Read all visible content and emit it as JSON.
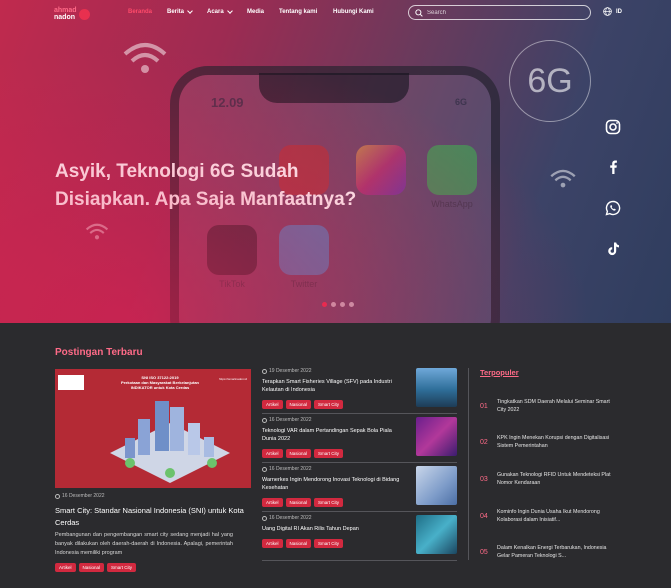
{
  "nav": {
    "logo": {
      "top": "ahmad",
      "bottom": "nadon"
    },
    "items": [
      {
        "label": "Beranda",
        "active": true,
        "dropdown": false
      },
      {
        "label": "Berita",
        "active": false,
        "dropdown": true
      },
      {
        "label": "Acara",
        "active": false,
        "dropdown": true
      },
      {
        "label": "Media",
        "active": false,
        "dropdown": false
      },
      {
        "label": "Tentang kami",
        "active": false,
        "dropdown": false
      },
      {
        "label": "Hubungi Kami",
        "active": false,
        "dropdown": false
      }
    ],
    "search_placeholder": "Search",
    "language": "ID"
  },
  "hero": {
    "title_line1": "Asyik, Teknologi 6G Sudah",
    "title_line2": "Disiapkan. Apa Saja  Manfaatnya?",
    "phone_time": "12.09",
    "phone_network": "6G",
    "badge": "6G",
    "app_labels": {
      "whatsapp": "WhatsApp",
      "tiktok": "TikTok",
      "twitter": "Twitter"
    },
    "slides": 4,
    "active_slide": 0
  },
  "social": [
    "instagram-icon",
    "facebook-icon",
    "whatsapp-icon",
    "tiktok-icon"
  ],
  "latest": {
    "section_title": "Postingan Terbaru",
    "featured": {
      "image_heading": "SNI ISO 37122:2019\nPerkotaan dan Masyarakat Berkelanjutan\nINDIKATOR untuk Kota Cerdas",
      "image_url": "https://smartnadon.id",
      "date": "16 Desember 2022",
      "title": "Smart City: Standar Nasional Indonesia (SNI) untuk Kota Cerdas",
      "excerpt": "Pembangunan dan pengembangan smart city sedang menjadi hal yang banyak dilakukan oleh daerah-daerah di Indonesia. Apalagi, pemerintah Indonesia memiliki program",
      "tags": [
        "Artikel",
        "Nasional",
        "Smart City"
      ]
    },
    "items": [
      {
        "date": "19 Desember 2022",
        "title": "Terapkan Smart Fisheries Village (SFV) pada Industri Kelautan di Indonesia",
        "tags": [
          "Artikel",
          "Nasional",
          "Smart City"
        ]
      },
      {
        "date": "16 Desember 2022",
        "title": "Teknologi VAR dalam Pertandingan Sepak Bola Piala Dunia 2022",
        "tags": [
          "Artikel",
          "Nasional",
          "Smart City"
        ]
      },
      {
        "date": "16 Desember 2022",
        "title": "Warnerkes Ingin Mendorong Inovasi Teknologi di Bidang Kesehatan",
        "tags": [
          "Artikel",
          "Nasional",
          "Smart City"
        ]
      },
      {
        "date": "16 Desember 2022",
        "title": "Uang Digital RI Akan Rilis Tahun Depan",
        "tags": [
          "Artikel",
          "Nasional",
          "Smart City"
        ]
      }
    ]
  },
  "popular": {
    "title": "Terpopuler",
    "items": [
      {
        "num": "01",
        "title": "Tingkatkan SDM Daerah Melalui Seminar Smart City 2022"
      },
      {
        "num": "02",
        "title": "KPK Ingin Menekan Korupsi dengan Digitalisasi Sistem Pemerintahan"
      },
      {
        "num": "03",
        "title": "Gunakan Teknologi RFID Untuk Mendeteksi Plat Nomor Kendaraan"
      },
      {
        "num": "04",
        "title": "Kominfo Ingin Dunia Usaha Ikut Mendorong Kolaborasi dalam Inisiatif..."
      },
      {
        "num": "05",
        "title": "Dalam Kenalkan Energi Terbarukan, Indonesia Gelar Pameran Teknologi S..."
      }
    ]
  },
  "colors": {
    "accent": "#e8304f",
    "accent_text": "#ff6b88",
    "background": "#2b2b2e"
  }
}
